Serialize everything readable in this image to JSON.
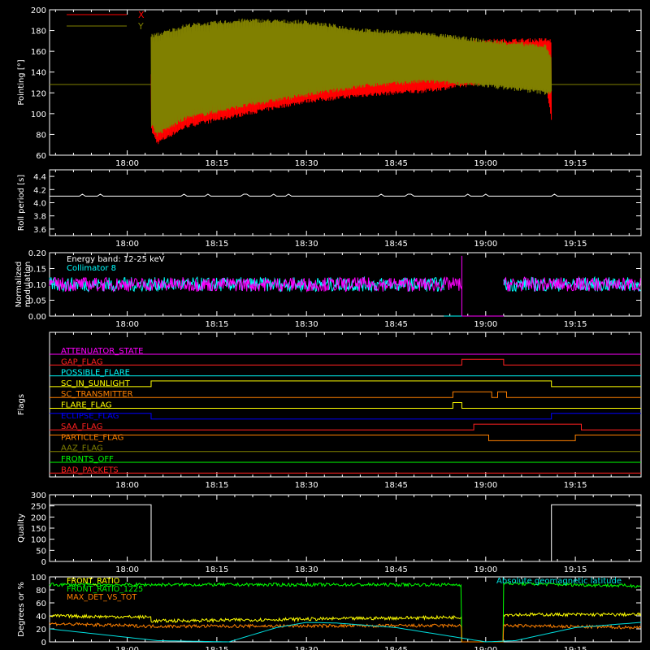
{
  "time_axis": {
    "tick_labels": [
      "18:00",
      "18:15",
      "18:30",
      "18:45",
      "19:00",
      "19:15"
    ],
    "tick_minutes": [
      1080,
      1095,
      1110,
      1125,
      1140,
      1155
    ],
    "range_minutes": [
      1067,
      1166
    ]
  },
  "chart_data": [
    {
      "type": "line",
      "title": "",
      "ylabel": "Pointing [°]",
      "ylim": [
        60,
        200
      ],
      "yticks": [
        60,
        80,
        100,
        120,
        140,
        160,
        180,
        200
      ],
      "legend": "top-left",
      "series": [
        {
          "name": "X",
          "color": "#ff0000",
          "envelope_x": [
            1084,
            1085,
            1090,
            1100,
            1110,
            1120,
            1130,
            1140,
            1150,
            1151
          ],
          "upper": [
            140,
            168,
            172,
            170,
            165,
            163,
            166,
            170,
            171,
            170
          ],
          "lower": [
            85,
            72,
            88,
            100,
            112,
            118,
            122,
            130,
            132,
            95
          ]
        },
        {
          "name": "Y",
          "color": "#808000",
          "envelope_x": [
            1084,
            1085,
            1090,
            1100,
            1110,
            1120,
            1130,
            1140,
            1150,
            1151
          ],
          "upper": [
            175,
            176,
            185,
            190,
            188,
            180,
            177,
            170,
            165,
            155
          ],
          "lower": [
            90,
            80,
            96,
            108,
            118,
            127,
            131,
            127,
            120,
            120
          ]
        }
      ],
      "baseline": 128
    },
    {
      "type": "line",
      "title": "",
      "ylabel": "Roll period [s]",
      "ylim": [
        3.5,
        4.5
      ],
      "yticks": [
        3.6,
        3.8,
        4.0,
        4.2,
        4.4
      ],
      "series": [
        {
          "name": "",
          "color": "#ffffff",
          "x": [
            1067,
            1166
          ],
          "y": [
            4.1,
            4.1
          ]
        }
      ]
    },
    {
      "type": "line",
      "title": "",
      "ylabel": "Normalized modulation",
      "ylim": [
        0,
        0.2
      ],
      "yticks": [
        0.0,
        0.05,
        0.1,
        0.15,
        0.2
      ],
      "annotations": [
        "Energy band: 12-25 keV"
      ],
      "series": [
        {
          "name": "Collimator 8",
          "color": "#00ffff",
          "segments": [
            [
              1067,
              1133
            ],
            [
              1143,
              1166
            ]
          ],
          "level": 0.1
        },
        {
          "name": "",
          "color": "#ff00ff",
          "segments": [
            [
              1067,
              1136
            ],
            [
              1143,
              1166
            ]
          ],
          "level": 0.1
        }
      ]
    },
    {
      "type": "line",
      "title": "",
      "ylabel": "Flags",
      "series": [
        {
          "name": "ATTENUATOR_STATE",
          "color": "#ff00ff",
          "steps": [
            [
              1067,
              0
            ]
          ]
        },
        {
          "name": "GAP_FLAG",
          "color": "#ff2020",
          "steps": [
            [
              1067,
              0
            ],
            [
              1136,
              1
            ],
            [
              1143,
              0
            ]
          ]
        },
        {
          "name": "POSSIBLE_FLARE",
          "color": "#00ffff",
          "steps": [
            [
              1067,
              0
            ]
          ]
        },
        {
          "name": "SC_IN_SUNLIGHT",
          "color": "#ffff00",
          "steps": [
            [
              1067,
              0
            ],
            [
              1084,
              1
            ],
            [
              1151,
              0
            ]
          ]
        },
        {
          "name": "SC_TRANSMITTER",
          "color": "#ff8000",
          "steps": [
            [
              1067,
              0
            ],
            [
              1134.5,
              1
            ],
            [
              1141,
              0
            ],
            [
              1142,
              1
            ],
            [
              1143.5,
              0
            ]
          ]
        },
        {
          "name": "FLARE_FLAG",
          "color": "#ffff00",
          "steps": [
            [
              1067,
              0
            ],
            [
              1134.5,
              1
            ],
            [
              1136,
              0
            ]
          ]
        },
        {
          "name": "ECLIPSE_FLAG",
          "color": "#0000ff",
          "steps": [
            [
              1067,
              1
            ],
            [
              1084,
              0
            ],
            [
              1151,
              1
            ]
          ]
        },
        {
          "name": "SAA_FLAG",
          "color": "#ff2020",
          "steps": [
            [
              1067,
              0
            ],
            [
              1138,
              1
            ],
            [
              1156,
              0
            ]
          ]
        },
        {
          "name": "PARTICLE_FLAG",
          "color": "#ff8000",
          "steps": [
            [
              1067,
              1
            ],
            [
              1140.5,
              0
            ],
            [
              1155,
              1
            ]
          ]
        },
        {
          "name": "AAZ_FLAG",
          "color": "#808000",
          "steps": [
            [
              1067,
              0
            ]
          ]
        },
        {
          "name": "FRONTS_OFF",
          "color": "#00ff00",
          "steps": [
            [
              1067,
              0
            ]
          ]
        },
        {
          "name": "BAD_PACKETS",
          "color": "#ff2020",
          "steps": [
            [
              1067,
              0
            ]
          ]
        }
      ]
    },
    {
      "type": "line",
      "title": "",
      "ylabel": "Quality",
      "ylim": [
        0,
        300
      ],
      "yticks": [
        0,
        50,
        100,
        150,
        200,
        250,
        300
      ],
      "series": [
        {
          "name": "",
          "color": "#ffffff",
          "x": [
            1067,
            1084,
            1084,
            1151,
            1151,
            1166
          ],
          "y": [
            255,
            255,
            0,
            0,
            255,
            255
          ]
        }
      ]
    },
    {
      "type": "line",
      "title": "",
      "ylabel": "Degrees or %",
      "ylim": [
        0,
        100
      ],
      "yticks": [
        0,
        20,
        40,
        60,
        80,
        100
      ],
      "legend": "top-left",
      "series": [
        {
          "name": "FRONT_RATIO",
          "color": "#ffff00",
          "x": [
            1067,
            1084,
            1084,
            1136,
            1136,
            1143,
            1143,
            1166
          ],
          "y": [
            40,
            38,
            32,
            38,
            0,
            0,
            42,
            42
          ]
        },
        {
          "name": "FRONT_RATIO_1225",
          "color": "#00ff00",
          "x": [
            1067,
            1136,
            1136,
            1143,
            1143,
            1166
          ],
          "y": [
            88,
            88,
            0,
            0,
            90,
            86
          ]
        },
        {
          "name": "MAX_DET_VS_TOT",
          "color": "#ff8000",
          "x": [
            1067,
            1084,
            1136,
            1136,
            1143,
            1143,
            1166
          ],
          "y": [
            28,
            24,
            25,
            0,
            0,
            25,
            22
          ]
        },
        {
          "name": "Absolute geomagnetic latitude",
          "color": "#00e0e0",
          "x": [
            1067,
            1085,
            1097,
            1105,
            1110,
            1115,
            1125,
            1140,
            1145,
            1155,
            1166
          ],
          "y": [
            20,
            2,
            0,
            22,
            30,
            29,
            22,
            0,
            2,
            22,
            30
          ]
        }
      ]
    }
  ],
  "flag_labels": [
    "ATTENUATOR_STATE",
    "GAP_FLAG",
    "POSSIBLE_FLARE",
    "SC_IN_SUNLIGHT",
    "SC_TRANSMITTER",
    "FLARE_FLAG",
    "ECLIPSE_FLAG",
    "SAA_FLAG",
    "PARTICLE_FLAG",
    "AAZ_FLAG",
    "FRONTS_OFF",
    "BAD_PACKETS"
  ]
}
